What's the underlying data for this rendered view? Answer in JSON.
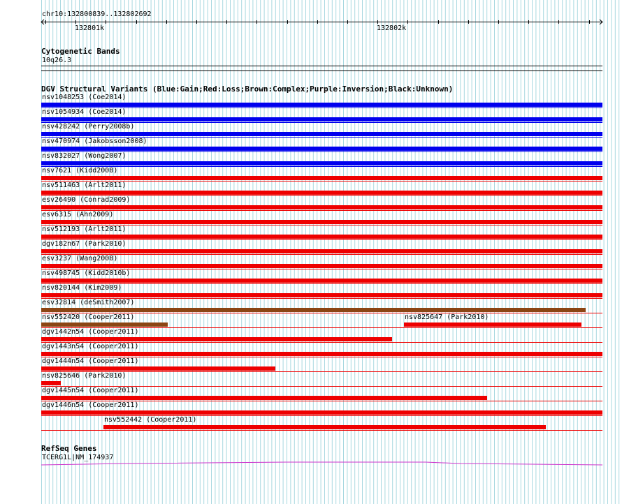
{
  "ruler": {
    "location": "chr10:132800839..132802692",
    "tick_labels": [
      "132801k",
      "132802k"
    ]
  },
  "cytoband": {
    "title": "Cytogenetic Bands",
    "band": "10q26.3"
  },
  "dgv": {
    "title": "DGV Structural Variants (Blue:Gain;Red:Loss;Brown:Complex;Purple:Inversion;Black:Unknown)",
    "colors": {
      "gain": "#0000ee",
      "loss": "#ee0000",
      "complex": "#8b4513",
      "inversion": "#800080",
      "unknown": "#000000"
    },
    "variants": [
      {
        "label": "nsv1048253 (Coe2014)",
        "type": "gain",
        "start": 0,
        "end": 1
      },
      {
        "label": "nsv1054934 (Coe2014)",
        "type": "gain",
        "start": 0,
        "end": 1
      },
      {
        "label": "nsv428242 (Perry2008b)",
        "type": "gain",
        "start": 0,
        "end": 1
      },
      {
        "label": "nsv470974 (Jakobsson2008)",
        "type": "gain",
        "start": 0,
        "end": 1
      },
      {
        "label": "nsv832027 (Wong2007)",
        "type": "gain",
        "start": 0,
        "end": 1
      },
      {
        "label": "nsv7621 (Kidd2008)",
        "type": "loss",
        "start": 0,
        "end": 1
      },
      {
        "label": "nsv511463 (Arlt2011)",
        "type": "loss",
        "start": 0,
        "end": 1
      },
      {
        "label": "esv26490 (Conrad2009)",
        "type": "loss",
        "start": 0,
        "end": 1
      },
      {
        "label": "esv6315 (Ahn2009)",
        "type": "loss",
        "start": 0,
        "end": 1
      },
      {
        "label": "nsv512193 (Arlt2011)",
        "type": "loss",
        "start": 0,
        "end": 1
      },
      {
        "label": "dgv182n67 (Park2010)",
        "type": "loss",
        "start": 0,
        "end": 1
      },
      {
        "label": "esv3237 (Wang2008)",
        "type": "loss",
        "start": 0,
        "end": 1
      },
      {
        "label": "nsv498745 (Kidd2010b)",
        "type": "loss",
        "start": 0,
        "end": 1
      },
      {
        "label": "nsv820144 (Kim2009)",
        "type": "loss",
        "start": 0,
        "end": 1
      },
      {
        "label": "esv32814 (deSmith2007)",
        "type": "complex",
        "start": 0,
        "end": 0.97
      },
      {
        "label": "nsv552420 (Cooper2011)",
        "type": "complex",
        "start": 0,
        "end": 0.226
      },
      {
        "label": "nsv825647 (Park2010)",
        "type": "loss",
        "start": 0.646,
        "end": 0.963
      },
      {
        "label": "dgv1442n54 (Cooper2011)",
        "type": "loss",
        "start": 0,
        "end": 0.625
      },
      {
        "label": "dgv1443n54 (Cooper2011)",
        "type": "loss",
        "start": 0,
        "end": 1
      },
      {
        "label": "dgv1444n54 (Cooper2011)",
        "type": "loss",
        "start": 0,
        "end": 0.417
      },
      {
        "label": "nsv825646 (Park2010)",
        "type": "loss",
        "start": 0,
        "end": 0.035
      },
      {
        "label": "dgv1445n54 (Cooper2011)",
        "type": "loss",
        "start": 0,
        "end": 0.795
      },
      {
        "label": "dgv1446n54 (Cooper2011)",
        "type": "loss",
        "start": 0,
        "end": 1
      },
      {
        "label": "nsv552442 (Cooper2011)",
        "type": "loss",
        "start": 0.111,
        "end": 0.899
      }
    ]
  },
  "refseq": {
    "title": "RefSeq Genes",
    "gene_label": "TCERG1L|NM_174937",
    "gene_color": "#cc33cc"
  }
}
